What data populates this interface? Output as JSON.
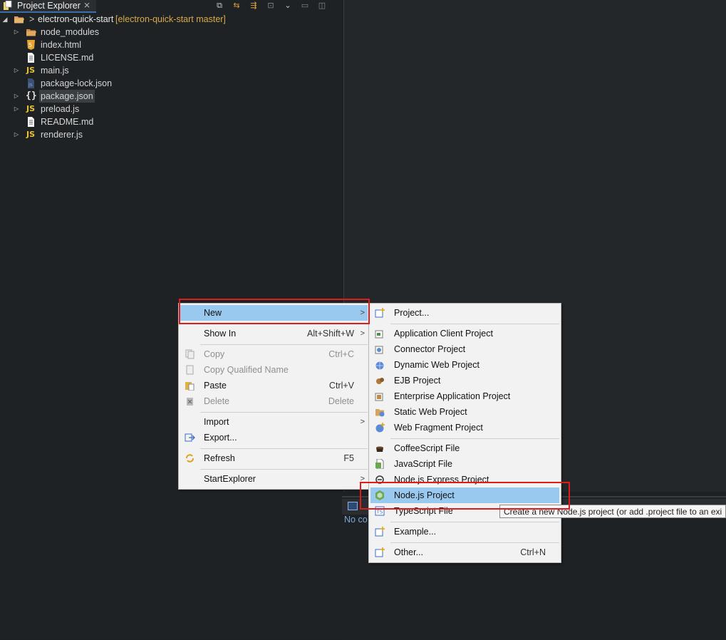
{
  "view": {
    "title": "Project Explorer",
    "toolbar_icons": [
      "collapse-all-icon",
      "link-with-editor-icon",
      "filters-icon",
      "focus-icon",
      "view-menu-icon",
      "minimize-icon",
      "maximize-icon"
    ]
  },
  "tree": {
    "project_prefix": ">",
    "project_name": "electron-quick-start",
    "project_repo": "[electron-quick-start master]",
    "items": [
      {
        "label": "node_modules",
        "icon": "folder-icon"
      },
      {
        "label": "index.html",
        "icon": "html-file-icon"
      },
      {
        "label": "LICENSE.md",
        "icon": "text-file-icon"
      },
      {
        "label": "main.js",
        "icon": "js-file-icon"
      },
      {
        "label": "package-lock.json",
        "icon": "json-file-icon"
      },
      {
        "label": "package.json",
        "icon": "json-braces-icon"
      },
      {
        "label": "preload.js",
        "icon": "js-file-icon"
      },
      {
        "label": "README.md",
        "icon": "text-file-icon"
      },
      {
        "label": "renderer.js",
        "icon": "js-file-icon"
      }
    ],
    "js_glyph": "JS",
    "json_glyph": "{}"
  },
  "bottom": {
    "status": "No co"
  },
  "context_menu": {
    "new": "New",
    "show_in": "Show In",
    "show_in_accel": "Alt+Shift+W",
    "copy": "Copy",
    "copy_accel": "Ctrl+C",
    "copy_qualified": "Copy Qualified Name",
    "paste": "Paste",
    "paste_accel": "Ctrl+V",
    "delete": "Delete",
    "delete_accel": "Delete",
    "import": "Import",
    "export": "Export...",
    "refresh": "Refresh",
    "refresh_accel": "F5",
    "start_explorer": "StartExplorer",
    "arrow": ">"
  },
  "new_submenu": {
    "project": "Project...",
    "app_client": "Application Client Project",
    "connector": "Connector Project",
    "dynamic_web": "Dynamic Web Project",
    "ejb": "EJB Project",
    "enterprise_app": "Enterprise Application Project",
    "static_web": "Static Web Project",
    "web_fragment": "Web Fragment Project",
    "coffeescript": "CoffeeScript File",
    "javascript": "JavaScript File",
    "node_express": "Node.js Express Project",
    "nodejs": "Node.js Project",
    "typescript": "TypeScript File",
    "example": "Example...",
    "other": "Other...",
    "other_accel": "Ctrl+N"
  },
  "tooltip": "Create a new Node.js project (or add .project file to an exi",
  "colors": {
    "highlight": "#99c9ef",
    "callout": "#e01b1b",
    "js_yellow": "#e9c431"
  }
}
